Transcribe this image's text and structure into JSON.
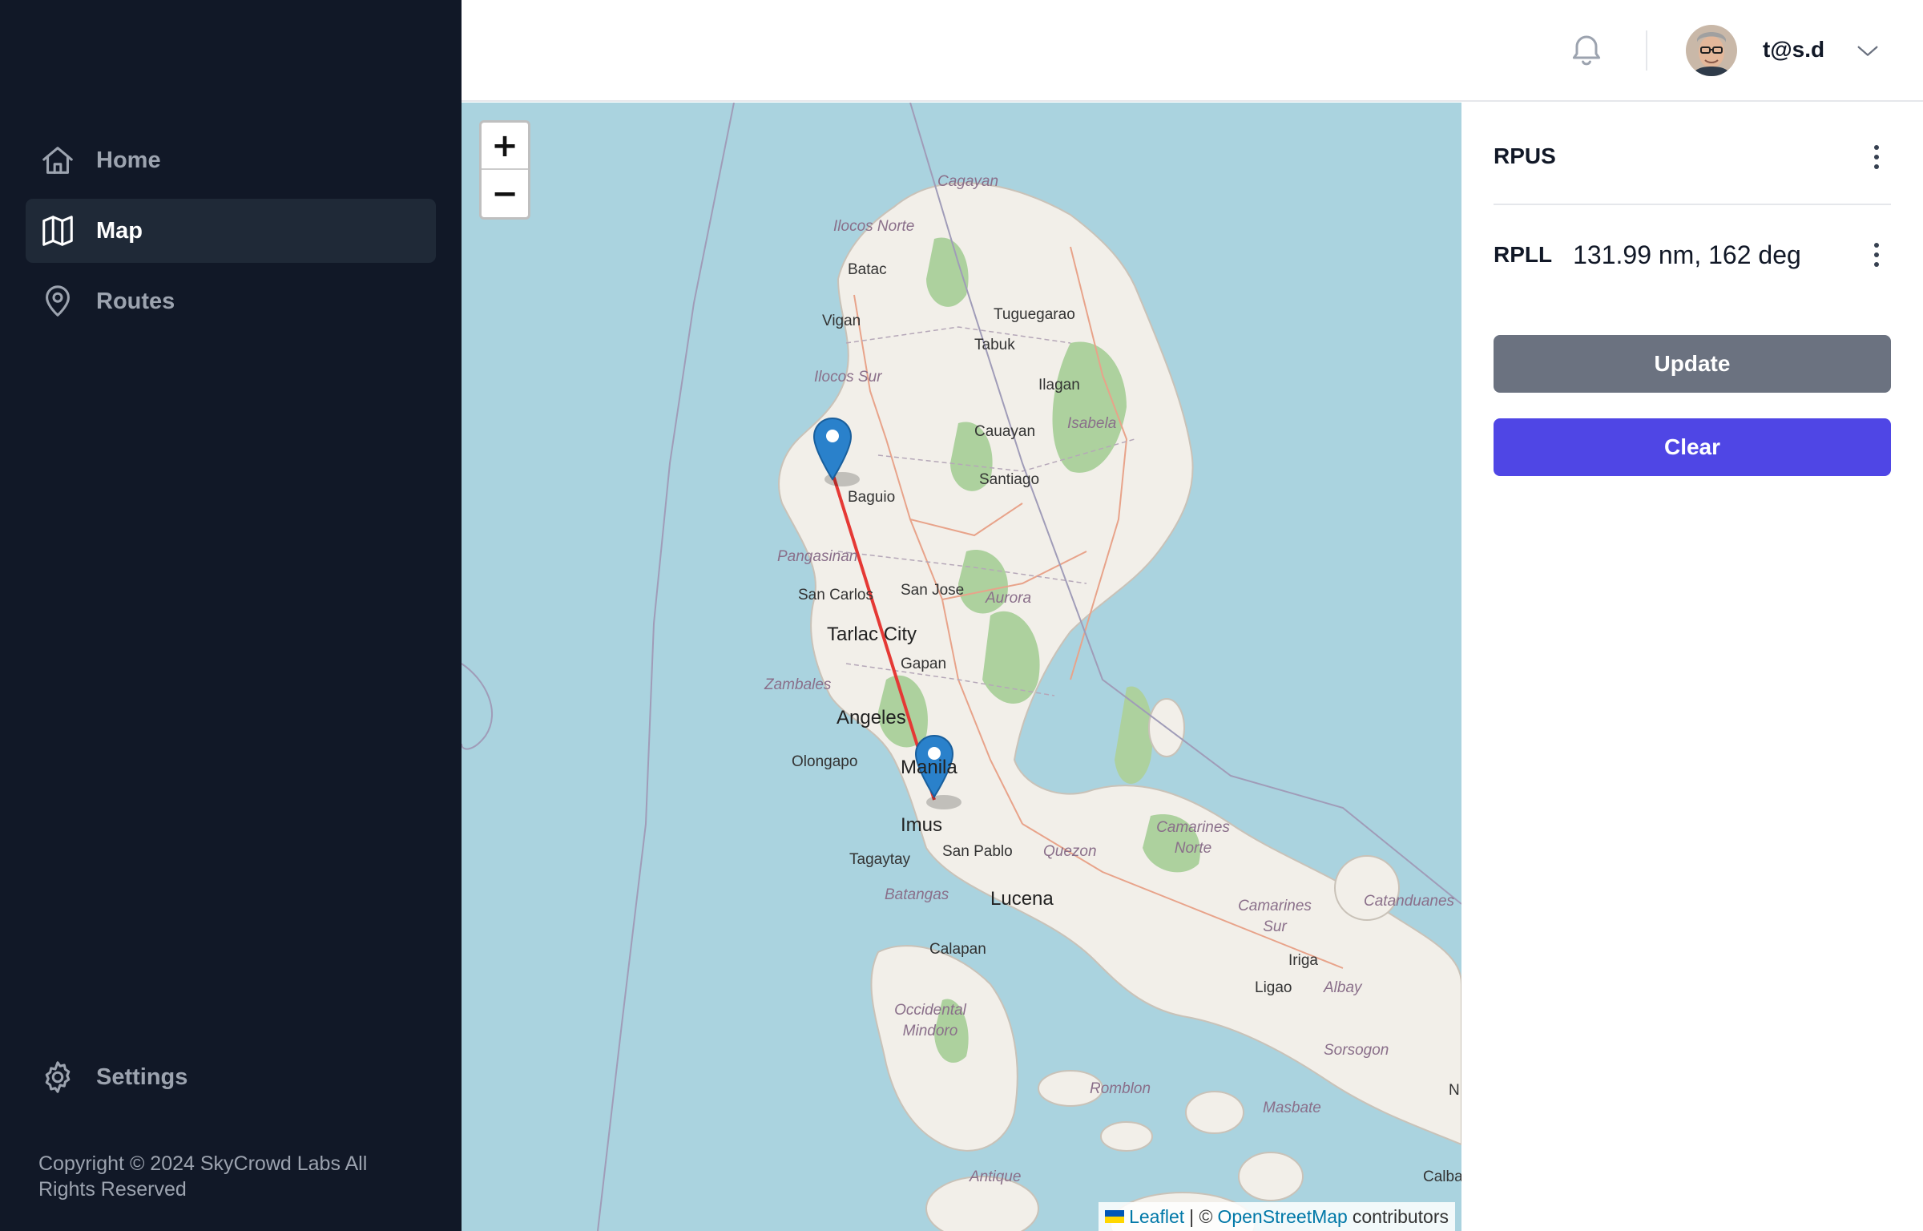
{
  "sidebar": {
    "items": [
      {
        "label": "Home",
        "icon": "home-icon"
      },
      {
        "label": "Map",
        "icon": "map-icon",
        "active": true
      },
      {
        "label": "Routes",
        "icon": "map-pin-icon"
      }
    ],
    "settings_label": "Settings",
    "copyright": "Copyright © 2024 SkyCrowd Labs All Rights Reserved",
    "bg_color": "#111827",
    "active_bg": "#1f2937"
  },
  "header": {
    "user_name": "t@s.d",
    "icons": [
      "bell-icon",
      "avatar",
      "chevron-down-icon"
    ]
  },
  "map": {
    "zoom_in": "+",
    "zoom_out": "−",
    "attribution": {
      "leaflet": "Leaflet",
      "separator": "| ©",
      "osm": "OpenStreetMap",
      "contributors": "contributors"
    },
    "route_color": "#e53935",
    "labels": {
      "cagayan": "Cagayan",
      "ilocos_norte": "Ilocos Norte",
      "batac": "Batac",
      "vigan": "Vigan",
      "tuguegarao": "Tuguegarao",
      "tabuk": "Tabuk",
      "ilocos_sur": "Ilocos Sur",
      "ilagan": "Ilagan",
      "cauayan": "Cauayan",
      "isabela": "Isabela",
      "santiago": "Santiago",
      "baguio": "Baguio",
      "pangasinan": "Pangasinan",
      "san_carlos": "San Carlos",
      "san_jose": "San Jose",
      "aurora": "Aurora",
      "tarlac_city": "Tarlac City",
      "gapan": "Gapan",
      "zambales": "Zambales",
      "angeles": "Angeles",
      "olongapo": "Olongapo",
      "manila": "Manila",
      "imus": "Imus",
      "san_pablo": "San Pablo",
      "quezon": "Quezon",
      "camarines_norte": "Camarines Norte",
      "tagaytay": "Tagaytay",
      "batangas": "Batangas",
      "lucena": "Lucena",
      "camarines_sur": "Camarines Sur",
      "catanduanes": "Catanduanes",
      "iriga": "Iriga",
      "ligao": "Ligao",
      "albay": "Albay",
      "calapan": "Calapan",
      "occidental_mindoro": "Occidental Mindoro",
      "sorsogon": "Sorsogon",
      "romblon": "Romblon",
      "masbate": "Masbate",
      "antique": "Antique",
      "calba": "Calba",
      "n": "N"
    }
  },
  "panel": {
    "rows": [
      {
        "code": "RPUS",
        "detail": ""
      },
      {
        "code": "RPLL",
        "detail": "131.99 nm, 162 deg"
      }
    ],
    "update_label": "Update",
    "clear_label": "Clear",
    "update_color": "#6b7280",
    "clear_color": "#4f46e5"
  }
}
